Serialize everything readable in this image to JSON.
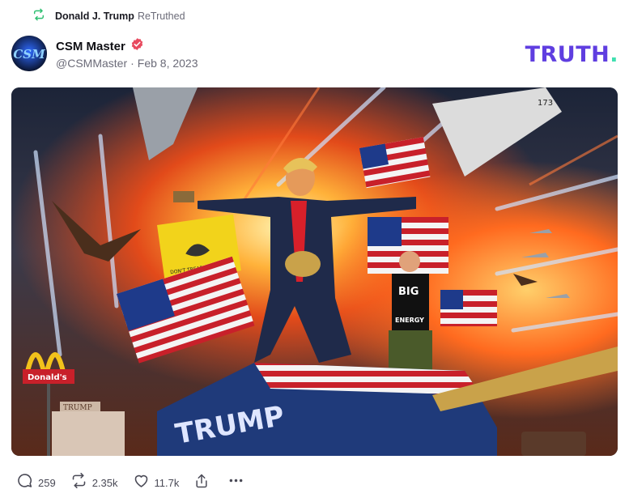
{
  "retruth": {
    "icon": "retruth-icon",
    "user": "Donald J. Trump",
    "suffix": "ReTruthed"
  },
  "post": {
    "author": {
      "display_name": "CSM Master",
      "verified": true,
      "handle": "@CSMMaster",
      "avatar_text": "CSM"
    },
    "separator": "·",
    "date": "Feb 8, 2023",
    "image": {
      "sign_donalds": "Donald's",
      "sign_trump_house": "TRUMP",
      "tank_text": "TRUMP",
      "flag_text": "DON'T TREAD ON ME",
      "shirt_line1": "BIG",
      "shirt_line2": "ENERGY",
      "jet_number": "173"
    }
  },
  "brand": {
    "word": "TRUTH",
    "dot": ".",
    "colors": {
      "word": "#5f3ee0",
      "dot": "#40e0b0"
    }
  },
  "actions": {
    "replies": "259",
    "retruths": "2.35k",
    "likes": "11.7k",
    "share_icon": "share-icon",
    "more_icon": "more-icon"
  },
  "colors": {
    "retruth_icon": "#2fbf71",
    "verified": "#e84a5f",
    "text_muted": "#6b6b78"
  }
}
